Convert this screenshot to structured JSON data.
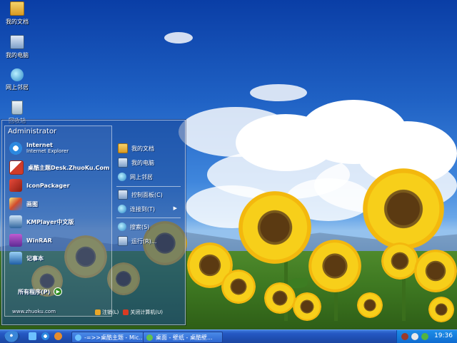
{
  "desktop": {
    "icons": [
      {
        "label": "我的文档",
        "icon": "my-documents-icon"
      },
      {
        "label": "我的电脑",
        "icon": "my-computer-icon"
      },
      {
        "label": "网上邻居",
        "icon": "network-icon"
      },
      {
        "label": "回收站",
        "icon": "recycle-bin-icon"
      }
    ]
  },
  "start_menu": {
    "user": "Administrator",
    "programs": [
      {
        "label": "Internet",
        "sub": "Internet Explorer",
        "icon": "internet-explorer-icon"
      },
      {
        "label": "桌酷主题Desk.ZhuoKu.Com",
        "icon": "zhuoku-theme-icon"
      },
      {
        "label": "IconPackager",
        "icon": "iconpackager-icon"
      },
      {
        "label": "画图",
        "icon": "paint-icon"
      },
      {
        "label": "KMPlayer中文版",
        "icon": "kmplayer-icon"
      },
      {
        "label": "WinRAR",
        "icon": "winrar-icon"
      },
      {
        "label": "记事本",
        "icon": "notepad-icon"
      }
    ],
    "all_programs": "所有程序(P)",
    "website": "www.zhuoku.com",
    "places": [
      {
        "label": "我的文档",
        "icon": "my-documents-icon"
      },
      {
        "label": "我的电脑",
        "icon": "my-computer-icon"
      },
      {
        "label": "网上邻居",
        "icon": "network-icon"
      },
      {
        "label": "控制面板(C)",
        "icon": "control-panel-icon"
      },
      {
        "label": "连接到(T)",
        "icon": "connect-to-icon"
      },
      {
        "label": "搜索(S)",
        "icon": "search-icon"
      },
      {
        "label": "运行(R)...",
        "icon": "run-icon"
      }
    ],
    "logoff": "注销(L)",
    "shutdown": "关闭计算机(U)"
  },
  "taskbar": {
    "tasks": [
      {
        "label": "-=>>桌酷主题 - Mic...",
        "icon": "browser-icon"
      },
      {
        "label": "桌面 - 壁纸 - 桌酷壁...",
        "icon": "browser-icon"
      }
    ],
    "clock": "19:36"
  },
  "colors": {
    "taskbar": "#2559c4",
    "tray": "#0f6bd0",
    "sky": "#1f61c4"
  }
}
